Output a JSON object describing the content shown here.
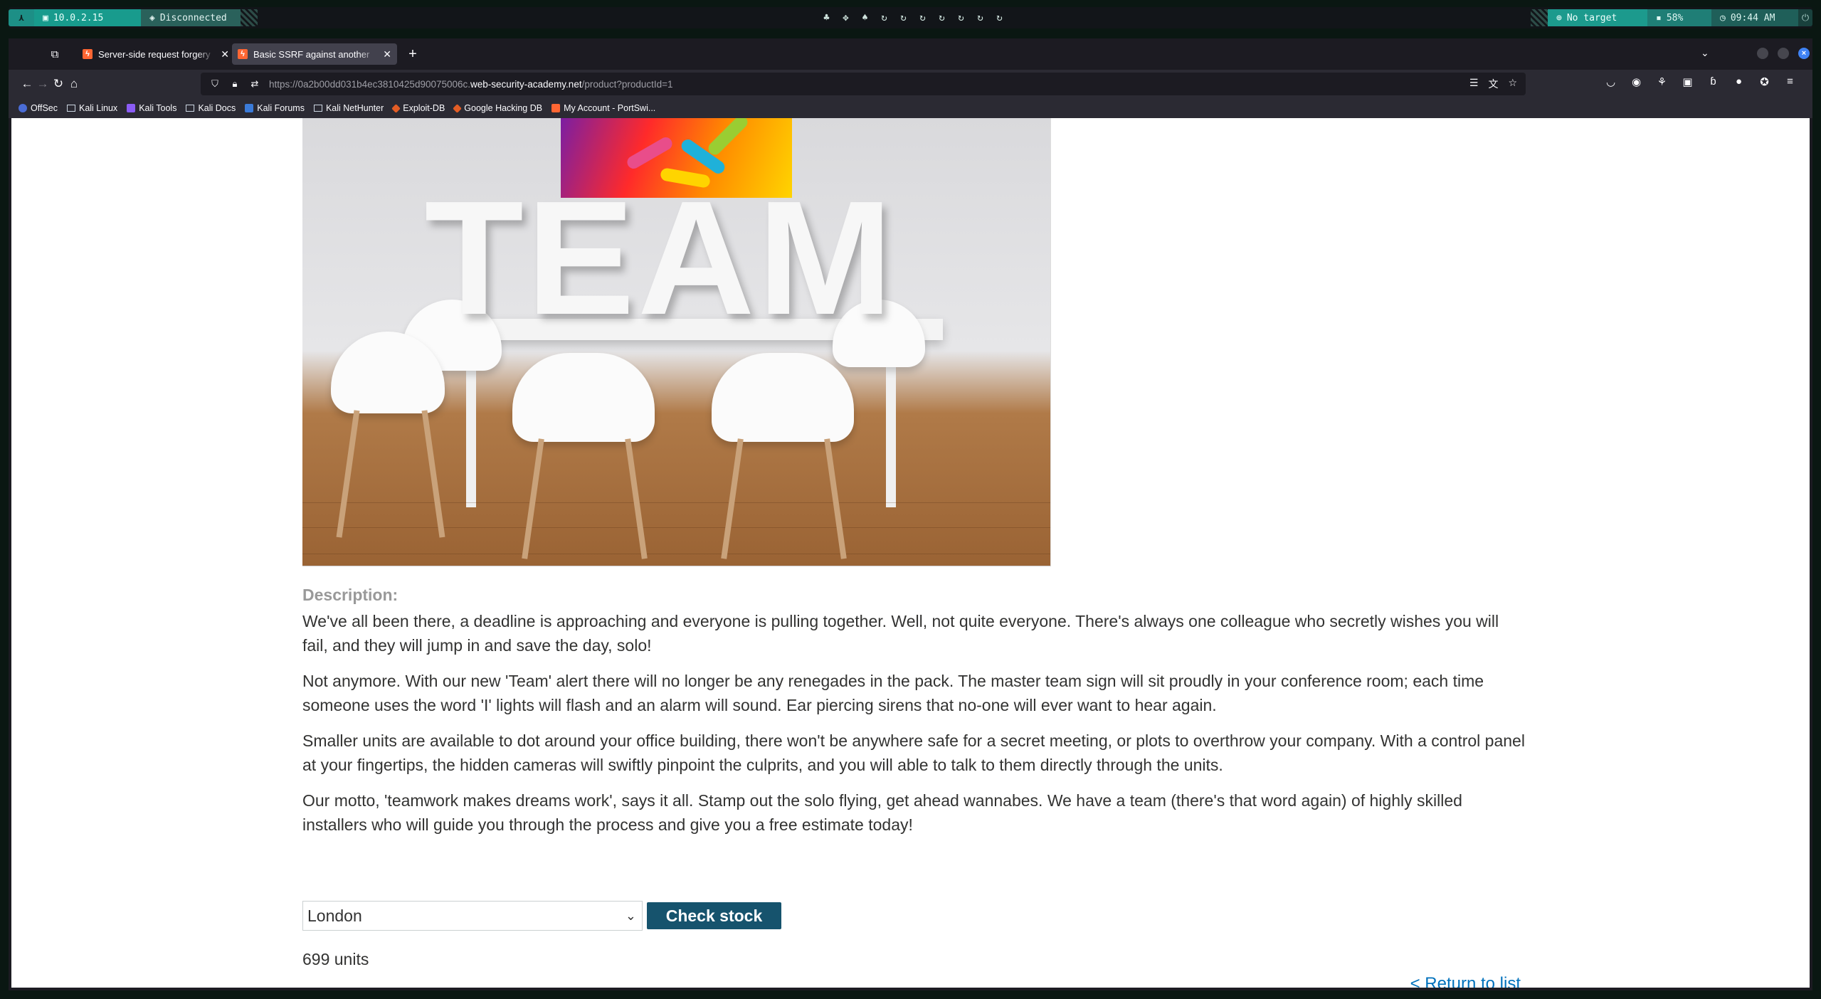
{
  "panel": {
    "ip": "10.0.2.15",
    "vpn_status": "Disconnected",
    "target": "No target",
    "battery": "58%",
    "time": "09:44 AM"
  },
  "browser": {
    "tabs": [
      {
        "title": "Server-side request forgery",
        "active": false
      },
      {
        "title": "Basic SSRF against another",
        "active": true
      }
    ],
    "url_prefix": "https://0a2b00dd031b4ec3810425d90075006c.",
    "url_host": "web-security-academy.net",
    "url_path": "/product?productId=1",
    "bookmarks": [
      {
        "label": "OffSec",
        "icon": "offsec"
      },
      {
        "label": "Kali Linux",
        "icon": "kali"
      },
      {
        "label": "Kali Tools",
        "icon": "tools"
      },
      {
        "label": "Kali Docs",
        "icon": "kali"
      },
      {
        "label": "Kali Forums",
        "icon": "forum"
      },
      {
        "label": "Kali NetHunter",
        "icon": "kali"
      },
      {
        "label": "Exploit-DB",
        "icon": "exploit"
      },
      {
        "label": "Google Hacking DB",
        "icon": "ghdb"
      },
      {
        "label": "My Account - PortSwi...",
        "icon": "ps"
      }
    ]
  },
  "product": {
    "image_text": "TEAM",
    "description_label": "Description:",
    "paragraphs": [
      "We've all been there, a deadline is approaching and everyone is pulling together. Well, not quite everyone. There's always one colleague who secretly wishes you will fail, and they will jump in and save the day, solo!",
      "Not anymore. With our new 'Team' alert there will no longer be any renegades in the pack. The master team sign will sit proudly in your conference room; each time someone uses the word 'I' lights will flash and an alarm will sound. Ear piercing sirens that no-one will ever want to hear again.",
      "Smaller units are available to dot around your office building, there won't be anywhere safe for a secret meeting, or plots to overthrow your company. With a control panel at your fingertips, the hidden cameras will swiftly pinpoint the culprits, and you will able to talk to them directly through the units.",
      "Our motto, 'teamwork makes dreams work', says it all. Stamp out the solo flying, get ahead wannabes. We have a team (there's that word again) of highly skilled installers who will guide you through the process and give you a free estimate today!"
    ],
    "store_selected": "London",
    "check_stock_label": "Check stock",
    "stock_result": "699 units",
    "return_link": "< Return to list"
  }
}
